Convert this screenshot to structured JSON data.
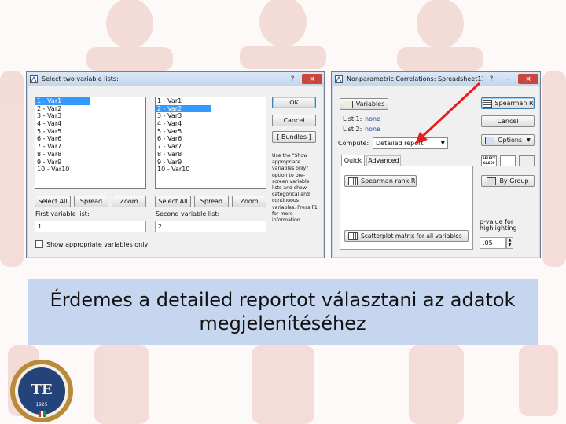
{
  "left_dialog": {
    "title": "Select two variable lists:",
    "title_help": "?",
    "title_close": "×",
    "list1_items": [
      "1 - Var1",
      "2 - Var2",
      "3 - Var3",
      "4 - Var4",
      "5 - Var5",
      "6 - Var6",
      "7 - Var7",
      "8 - Var8",
      "9 - Var9",
      "10 - Var10"
    ],
    "list2_items": [
      "1 - Var1",
      "2 - Var2",
      "3 - Var3",
      "4 - Var4",
      "5 - Var5",
      "6 - Var6",
      "7 - Var7",
      "8 - Var8",
      "9 - Var9",
      "10 - Var10"
    ],
    "list1_selected": 0,
    "list2_selected": 1,
    "ok_label": "OK",
    "cancel_label": "Cancel",
    "bundles_label": "[ Bundles ]",
    "help_text": "Use the \"Show appropriate variables only\" option to pre-screen variable lists and show categorical and continuous variables. Press F1 for more information.",
    "select_all_label": "Select All",
    "spread_label": "Spread",
    "zoom_label": "Zoom",
    "first_list_label": "First variable list:",
    "second_list_label": "Second variable list:",
    "first_list_value": "1",
    "second_list_value": "2",
    "show_appropriate_label": "Show appropriate variables only"
  },
  "right_dialog": {
    "title": "Nonparametric Correlations: Spreadsheet11",
    "title_help": "?",
    "title_min": "–",
    "title_close": "×",
    "variables_label": "Variables",
    "list1_label": "List 1:",
    "list1_value": "none",
    "list2_label": "List 2:",
    "list2_value": "none",
    "compute_label": "Compute:",
    "compute_value": "Detailed report",
    "tab_quick": "Quick",
    "tab_advanced": "Advanced",
    "spearman_rank_label": "Spearman rank R",
    "scatterplot_label": "Scatterplot matrix for all variables",
    "spearman_btn_label": "Spearman R",
    "cancel_label": "Cancel",
    "options_label": "Options",
    "by_group_label": "By Group",
    "p_value_label": "p-value for highlighting",
    "p_value": ".05"
  },
  "caption": {
    "text": "Érdemes a detailed reportot választani az adatok megjelenítéséhez"
  },
  "logo": {
    "letters": "TE",
    "year": "1925"
  },
  "colors": {
    "caption_bg": "#c6d6ee",
    "arrow": "#e81c1c",
    "selection": "#3399ff"
  }
}
